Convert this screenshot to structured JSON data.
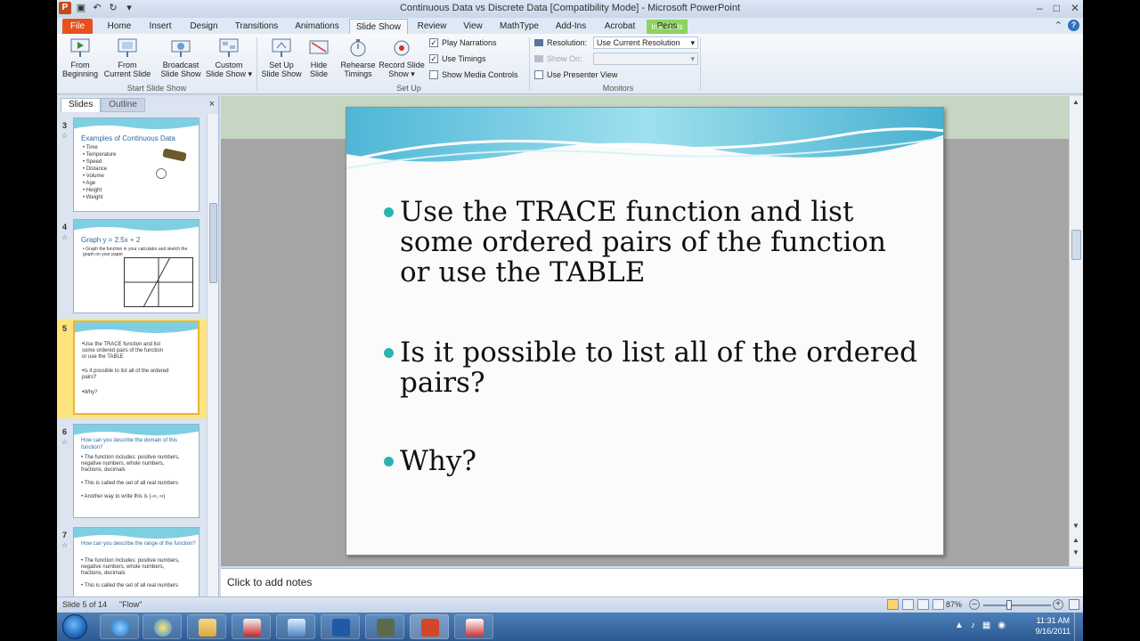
{
  "window": {
    "title": "Continuous Data vs Discrete Data [Compatibility Mode]  -  Microsoft PowerPoint"
  },
  "tabs": [
    {
      "label": "File"
    },
    {
      "label": "Home"
    },
    {
      "label": "Insert"
    },
    {
      "label": "Design"
    },
    {
      "label": "Transitions"
    },
    {
      "label": "Animations"
    },
    {
      "label": "Slide Show"
    },
    {
      "label": "Review"
    },
    {
      "label": "View"
    },
    {
      "label": "MathType"
    },
    {
      "label": "Add-Ins"
    },
    {
      "label": "Acrobat"
    },
    {
      "label": "Pens"
    }
  ],
  "contextual_tab": "Ink Tools",
  "ribbon": {
    "from_beginning": [
      "From",
      "Beginning"
    ],
    "from_current": [
      "From",
      "Current Slide"
    ],
    "broadcast": [
      "Broadcast",
      "Slide Show"
    ],
    "custom": [
      "Custom",
      "Slide Show ▾"
    ],
    "group_start": "Start Slide Show",
    "setup": [
      "Set Up",
      "Slide Show"
    ],
    "hide": [
      "Hide",
      "Slide"
    ],
    "rehearse": [
      "Rehearse",
      "Timings"
    ],
    "record": [
      "Record Slide",
      "Show ▾"
    ],
    "play_narrations": "Play Narrations",
    "use_timings": "Use Timings",
    "show_media": "Show Media Controls",
    "group_setup": "Set Up",
    "resolution_label": "Resolution:",
    "resolution_value": "Use Current Resolution",
    "show_on_label": "Show On:",
    "use_presenter": "Use Presenter View",
    "group_monitors": "Monitors"
  },
  "left_panel": {
    "tab_slides": "Slides",
    "tab_outline": "Outline",
    "close": "×",
    "thumbnails": [
      {
        "num": "3",
        "title": "Examples of Continuous Data",
        "lines": [
          "• Time",
          "• Temperature",
          "• Speed",
          "• Distance",
          "• Volume",
          "• Age",
          "• Height",
          "• Weight"
        ]
      },
      {
        "num": "4",
        "title": "Graph y = 2.5x + 2",
        "lines": [
          "• Graph the function in your calculator and sketch the",
          "  graph on your paper"
        ]
      },
      {
        "num": "5",
        "title": "",
        "lines": [
          "•Use the TRACE function and list",
          "  some ordered  pairs of the function",
          "  or use the TABLE",
          "",
          "•Is it possible to list all of the ordered",
          "  pairs?",
          "",
          "•Why?"
        ]
      },
      {
        "num": "6",
        "title": "How can you describe the domain of this function?",
        "lines": [
          "• The function includes: positive numbers,",
          "  negative numbers, whole numbers,",
          "  fractions, decimals",
          "",
          "• This is called the set of all real numbers",
          "",
          "• Another way to write this is (-∞, ∞)"
        ]
      },
      {
        "num": "7",
        "title": "How can you describe the range of the function?",
        "lines": [
          "• The function includes: positive numbers,",
          "  negative numbers, whole numbers,",
          "  fractions, decimals",
          "",
          "• This is called the set of all real numbers"
        ]
      }
    ]
  },
  "slide": {
    "bullets": [
      "Use the TRACE function and list some ordered pairs of the function or use the TABLE",
      "Is it possible to list all of the ordered pairs?",
      "Why?"
    ]
  },
  "notes_placeholder": "Click to add notes",
  "status": {
    "slide_info": "Slide 5 of 14",
    "theme": "\"Flow\"",
    "zoom": "87%"
  },
  "taskbar": {
    "time": "11:31 AM",
    "date": "9/16/2011"
  },
  "colors": {
    "accent_teal": "#2bb3b3",
    "file_tab": "#e8501c",
    "ink_tools": "#8ed35f"
  }
}
